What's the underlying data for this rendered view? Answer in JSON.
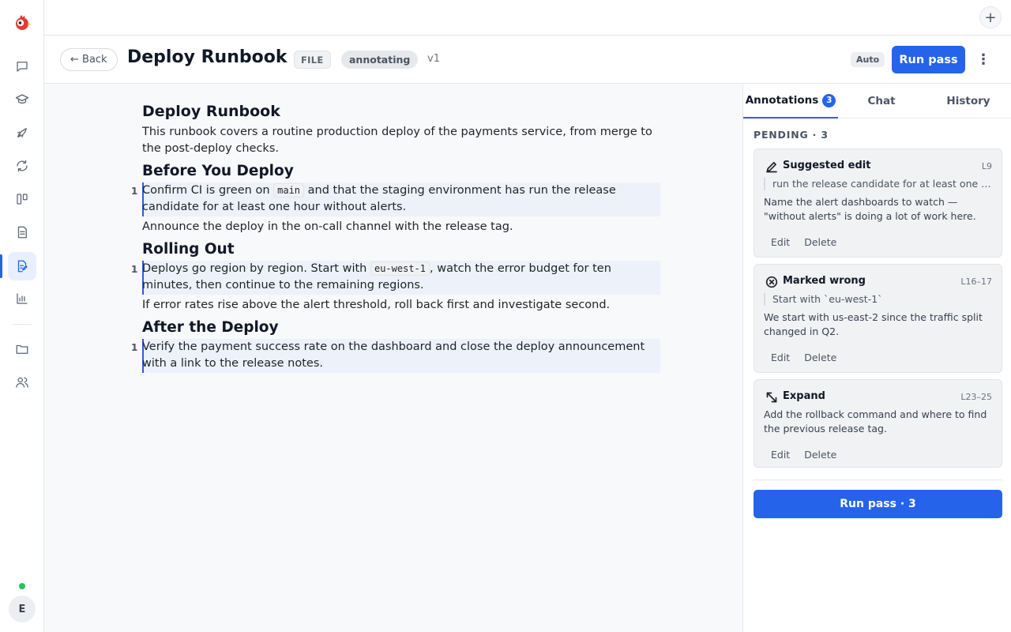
{
  "rail": {
    "items": [
      {
        "name": "chat"
      },
      {
        "name": "learn"
      },
      {
        "name": "launch"
      },
      {
        "name": "sync"
      },
      {
        "name": "board"
      },
      {
        "name": "documents"
      },
      {
        "name": "review",
        "active": true
      },
      {
        "name": "analytics"
      },
      {
        "name": "files"
      },
      {
        "name": "people"
      }
    ],
    "avatar_initial": "E",
    "status": "online"
  },
  "topbar": {
    "add_label": "+"
  },
  "header": {
    "back_label": "← Back",
    "title": "Deploy Runbook",
    "file_badge": "FILE",
    "status": "annotating",
    "version": "v1",
    "auto_label": "Auto",
    "run_pass_label": "Run pass",
    "more_label": "⋮"
  },
  "document": {
    "title": "Deploy Runbook",
    "intro": "This runbook covers a routine production deploy of the payments service, from merge to the post-deploy checks.",
    "sections": [
      {
        "heading": "Before You Deploy",
        "annotated": {
          "count": "1",
          "before_code": "Confirm CI is green on ",
          "code": "main",
          "after_code": " and that the staging environment has run the release candidate for at least one hour without alerts."
        },
        "plain": "Announce the deploy in the on-call channel with the release tag."
      },
      {
        "heading": "Rolling Out",
        "annotated": {
          "count": "1",
          "before_code": "Deploys go region by region. Start with ",
          "code": "eu-west-1",
          "after_code": ", watch the error budget for ten minutes, then continue to the remaining regions."
        },
        "plain": "If error rates rise above the alert threshold, roll back first and investigate second."
      },
      {
        "heading": "After the Deploy",
        "annotated": {
          "count": "1",
          "text": "Verify the payment success rate on the dashboard and close the deploy announcement with a link to the release notes."
        }
      }
    ]
  },
  "panel": {
    "tabs": [
      {
        "label": "Annotations",
        "count": "3",
        "active": true
      },
      {
        "label": "Chat"
      },
      {
        "label": "History"
      }
    ],
    "pending_label": "PENDING · 3",
    "cards": [
      {
        "type": "Suggested edit",
        "icon": "pencil-icon",
        "location": "L9",
        "quote": "run the release candidate for at least one hour without alerts.",
        "comment": "Name the alert dashboards to watch — \"without alerts\" is doing a lot of work here.",
        "edit_label": "Edit",
        "delete_label": "Delete"
      },
      {
        "type": "Marked wrong",
        "icon": "x-circle-icon",
        "location": "L16–17",
        "quote": "Start with `eu-west-1`",
        "comment": "We start with us-east-2 since the traffic split changed in Q2.",
        "edit_label": "Edit",
        "delete_label": "Delete"
      },
      {
        "type": "Expand",
        "icon": "expand-icon",
        "location": "L23–25",
        "comment": "Add the rollback command and where to find the previous release tag.",
        "edit_label": "Edit",
        "delete_label": "Delete"
      }
    ],
    "run_pass_label": "Run pass · 3"
  },
  "colors": {
    "accent": "#2563eb",
    "highlight": "#edf1fa",
    "status_online": "#22c55e"
  }
}
